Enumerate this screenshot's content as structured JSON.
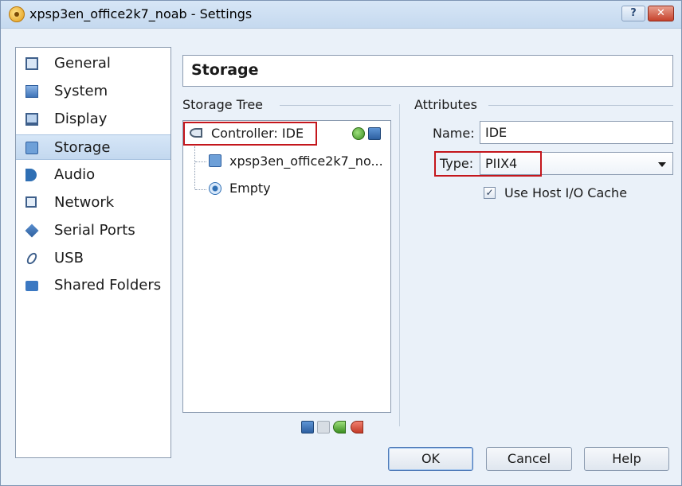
{
  "window": {
    "title": "xpsp3en_office2k7_noab - Settings",
    "help_button": "?",
    "close_button": "✕"
  },
  "sidebar": {
    "items": [
      {
        "label": "General",
        "icon": "general-icon"
      },
      {
        "label": "System",
        "icon": "system-icon"
      },
      {
        "label": "Display",
        "icon": "display-icon"
      },
      {
        "label": "Storage",
        "icon": "storage-icon",
        "selected": true
      },
      {
        "label": "Audio",
        "icon": "audio-icon"
      },
      {
        "label": "Network",
        "icon": "network-icon"
      },
      {
        "label": "Serial Ports",
        "icon": "serial-ports-icon"
      },
      {
        "label": "USB",
        "icon": "usb-icon"
      },
      {
        "label": "Shared Folders",
        "icon": "shared-folders-icon"
      }
    ]
  },
  "page": {
    "title": "Storage"
  },
  "storage_tree": {
    "title": "Storage Tree",
    "controller": "Controller: IDE",
    "attachments": [
      {
        "label": "xpsp3en_office2k7_no...",
        "icon": "hard-disk-icon"
      },
      {
        "label": "Empty",
        "icon": "cd-drive-icon"
      }
    ]
  },
  "attributes": {
    "title": "Attributes",
    "name_label": "Name:",
    "name_value": "IDE",
    "type_label": "Type:",
    "type_value": "PIIX4",
    "host_io_cache_label": "Use Host I/O Cache",
    "host_io_cache_checked": true,
    "check_mark": "✓"
  },
  "buttons": {
    "ok": "OK",
    "cancel": "Cancel",
    "help": "Help"
  },
  "colors": {
    "highlight": "#c4161c",
    "selection": "#c3d8ef",
    "window_bg": "#eaf1f9"
  }
}
